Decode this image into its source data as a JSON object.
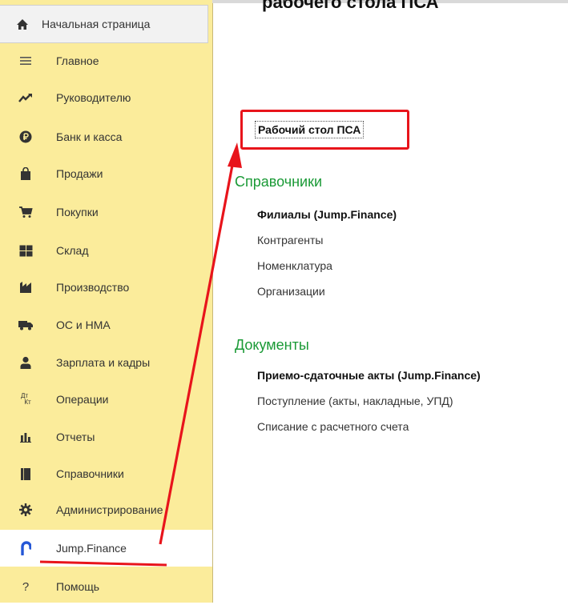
{
  "header": {
    "partial_title": "рабочего стола ПСА"
  },
  "sidebar": {
    "home": {
      "label": "Начальная страница",
      "icon": "home-icon"
    },
    "items": [
      {
        "label": "Главное",
        "icon": "menu-lines-icon"
      },
      {
        "label": "Руководителю",
        "icon": "trend-chart-icon"
      },
      {
        "label": "Банк и касса",
        "icon": "ruble-coin-icon"
      },
      {
        "label": "Продажи",
        "icon": "shopping-bag-icon"
      },
      {
        "label": "Покупки",
        "icon": "shopping-cart-icon"
      },
      {
        "label": "Склад",
        "icon": "warehouse-grid-icon"
      },
      {
        "label": "Производство",
        "icon": "factory-icon"
      },
      {
        "label": "ОС и НМА",
        "icon": "truck-icon"
      },
      {
        "label": "Зарплата и кадры",
        "icon": "person-icon"
      },
      {
        "label": "Операции",
        "icon": "debit-credit-icon",
        "icon_text_top": "Дт",
        "icon_text_bottom": "Кт"
      },
      {
        "label": "Отчеты",
        "icon": "bar-chart-icon"
      },
      {
        "label": "Справочники",
        "icon": "book-icon"
      },
      {
        "label": "Администрирование",
        "icon": "gear-icon"
      },
      {
        "label": "Jump.Finance",
        "icon": "jump-finance-logo-icon",
        "active": true
      },
      {
        "label": "Помощь",
        "icon": "question-icon",
        "icon_text": "?"
      }
    ]
  },
  "main": {
    "desk_link": "Рабочий стол ПСА",
    "sections": [
      {
        "title": "Справочники",
        "links": [
          {
            "label": "Филиалы (Jump.Finance)",
            "bold": true
          },
          {
            "label": "Контрагенты",
            "bold": false
          },
          {
            "label": "Номенклатура",
            "bold": false
          },
          {
            "label": "Организации",
            "bold": false
          }
        ]
      },
      {
        "title": "Документы",
        "links": [
          {
            "label": "Приемо-сдаточные акты (Jump.Finance)",
            "bold": true
          },
          {
            "label": "Поступление (акты, накладные, УПД)",
            "bold": false
          },
          {
            "label": "Списание с расчетного счета",
            "bold": false
          }
        ]
      }
    ]
  },
  "colors": {
    "sidebar_bg": "#fbec9b",
    "section_title": "#1a9a36",
    "annotation_red": "#e8141b",
    "jump_logo_blue": "#2557d6"
  }
}
